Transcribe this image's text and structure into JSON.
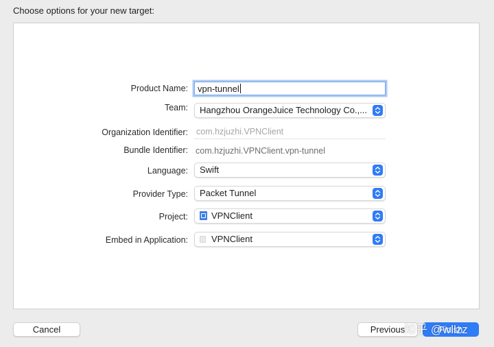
{
  "dialog": {
    "title": "Choose options for your new target:"
  },
  "form": {
    "product_name": {
      "label": "Product Name:",
      "value": "vpn-tunnel"
    },
    "team": {
      "label": "Team:",
      "value": "Hangzhou OrangeJuice Technology Co.,..."
    },
    "organization_identifier": {
      "label": "Organization Identifier:",
      "placeholder": "com.hzjuzhi.VPNClient"
    },
    "bundle_identifier": {
      "label": "Bundle Identifier:",
      "value": "com.hzjuzhi.VPNClient.vpn-tunnel"
    },
    "language": {
      "label": "Language:",
      "value": "Swift"
    },
    "provider_type": {
      "label": "Provider Type:",
      "value": "Packet Tunnel"
    },
    "project": {
      "label": "Project:",
      "value": "VPNClient"
    },
    "embed_in_application": {
      "label": "Embed in Application:",
      "value": "VPNClient"
    }
  },
  "buttons": {
    "cancel": "Cancel",
    "previous": "Previous",
    "finish": "Finish"
  },
  "watermark": "知乎 @wllzz",
  "colors": {
    "accent": "#2f7cf6",
    "focus_ring": "#a9c8f3",
    "background": "#ececec"
  },
  "icons": {
    "popup": "chevron-up-down-icon",
    "project": "xcode-project-icon",
    "embed": "app-icon"
  }
}
